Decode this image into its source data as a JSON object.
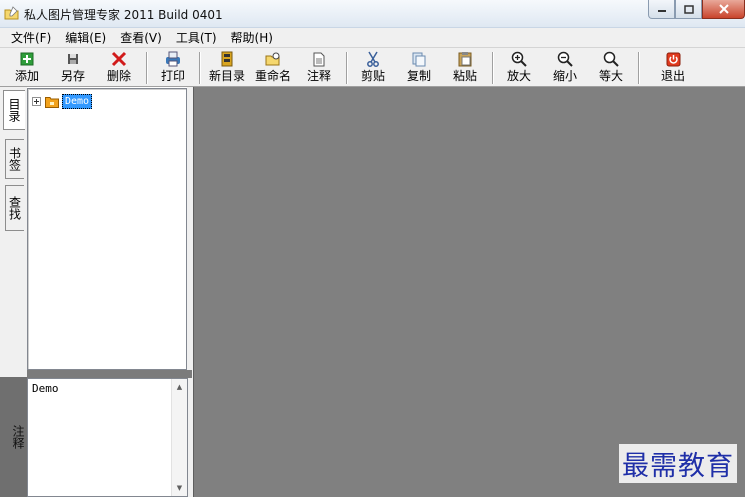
{
  "window": {
    "title": "私人图片管理专家 2011 Build 0401",
    "icons": {
      "app": "folder-pencil-icon",
      "minimize": "minimize-icon",
      "maximize": "maximize-icon",
      "close": "close-icon"
    }
  },
  "menu": {
    "items": [
      "文件(F)",
      "编辑(E)",
      "查看(V)",
      "工具(T)",
      "帮助(H)"
    ]
  },
  "toolbar": {
    "buttons": [
      {
        "label": "添加",
        "icon": "add-green-icon"
      },
      {
        "label": "另存",
        "icon": "floppy-disk-icon"
      },
      {
        "label": "删除",
        "icon": "red-x-icon"
      },
      {
        "label": "打印",
        "icon": "printer-icon"
      },
      {
        "label": "新目录",
        "icon": "new-folder-film-icon"
      },
      {
        "label": "重命名",
        "icon": "rename-folder-icon"
      },
      {
        "label": "注释",
        "icon": "document-note-icon"
      },
      {
        "label": "剪贴",
        "icon": "scissors-icon"
      },
      {
        "label": "复制",
        "icon": "copy-icon"
      },
      {
        "label": "粘贴",
        "icon": "paste-clipboard-icon"
      },
      {
        "label": "放大",
        "icon": "zoom-in-icon"
      },
      {
        "label": "缩小",
        "icon": "zoom-out-icon"
      },
      {
        "label": "等大",
        "icon": "zoom-actual-icon"
      },
      {
        "label": "退出",
        "icon": "exit-power-icon"
      }
    ]
  },
  "left_tabs": {
    "items": [
      "目录",
      "书签",
      "查找"
    ],
    "active": "目录"
  },
  "tree": {
    "root_label": "Demo",
    "expanded": false
  },
  "note": {
    "label": "注释",
    "text": "Demo"
  },
  "watermark": {
    "text": "最需教育"
  },
  "colors": {
    "viewer_background": "#808080",
    "selection": "#3399ff",
    "watermark": "#1f2fa8"
  }
}
